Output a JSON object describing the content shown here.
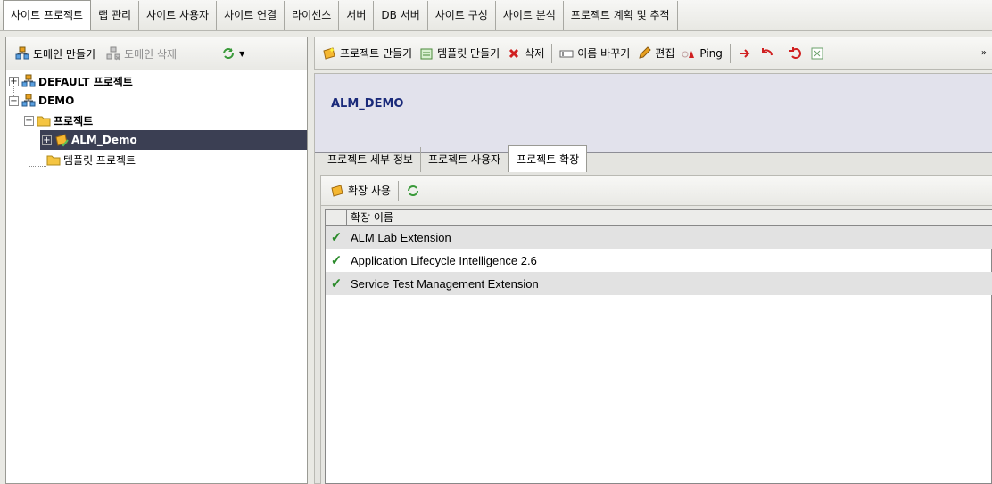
{
  "top_tabs": [
    {
      "label": "사이트 프로젝트",
      "active": true
    },
    {
      "label": "랩 관리"
    },
    {
      "label": "사이트 사용자"
    },
    {
      "label": "사이트 연결"
    },
    {
      "label": "라이센스"
    },
    {
      "label": "서버"
    },
    {
      "label": "DB 서버"
    },
    {
      "label": "사이트 구성"
    },
    {
      "label": "사이트 분석"
    },
    {
      "label": "프로젝트 계획 및 추적"
    }
  ],
  "left_toolbar": {
    "create_domain": "도메인 만들기",
    "delete_domain": "도메인 삭제"
  },
  "tree": {
    "default_project": "DEFAULT 프로젝트",
    "demo": "DEMO",
    "projects_folder": "프로젝트",
    "alm_demo": "ALM_Demo",
    "template_projects": "템플릿 프로젝트"
  },
  "right_toolbar": {
    "create_project": "프로젝트 만들기",
    "create_template": "템플릿 만들기",
    "delete": "삭제",
    "rename": "이름 바꾸기",
    "edit": "편집",
    "ping": "Ping"
  },
  "project_header": {
    "title": "ALM_DEMO"
  },
  "sub_tabs": [
    {
      "label": "프로젝트 세부 정보"
    },
    {
      "label": "프로젝트 사용자"
    },
    {
      "label": "프로젝트 확장",
      "active": true
    }
  ],
  "extensions": {
    "enable_label": "확장 사용",
    "column_header": "확장 이름",
    "rows": [
      {
        "name": "ALM Lab Extension"
      },
      {
        "name": "Application Lifecycle Intelligence 2.6"
      },
      {
        "name": "Service Test Management Extension"
      }
    ]
  },
  "colors": {
    "selected_bg": "#3b3f53",
    "title": "#1a2a7a",
    "check": "#2a8a2a"
  }
}
